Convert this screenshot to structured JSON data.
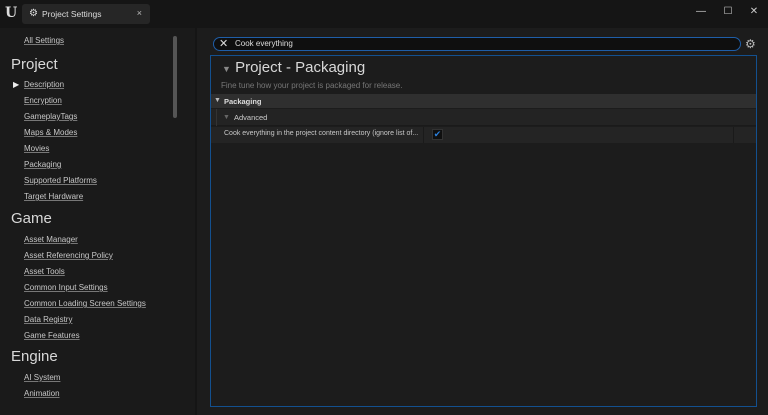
{
  "window": {
    "tab_title": "Project Settings",
    "close": "×",
    "minimize": "—",
    "maximize": "☐",
    "close_window": "✕"
  },
  "sidebar": {
    "all_settings": "All Settings",
    "sections": [
      {
        "title": "Project",
        "items": [
          "Description",
          "Encryption",
          "GameplayTags",
          "Maps & Modes",
          "Movies",
          "Packaging",
          "Supported Platforms",
          "Target Hardware"
        ]
      },
      {
        "title": "Game",
        "items": [
          "Asset Manager",
          "Asset Referencing Policy",
          "Asset Tools",
          "Common Input Settings",
          "Common Loading Screen Settings",
          "Data Registry",
          "Game Features"
        ]
      },
      {
        "title": "Engine",
        "items": [
          "AI System",
          "Animation"
        ]
      }
    ]
  },
  "search": {
    "value": "Cook everything"
  },
  "content": {
    "title": "Project - Packaging",
    "description": "Fine tune how your project is packaged for release.",
    "category": "Packaging",
    "subcategory": "Advanced",
    "property": {
      "label": "Cook everything in the project content directory (ignore list of...",
      "checked": true
    }
  }
}
